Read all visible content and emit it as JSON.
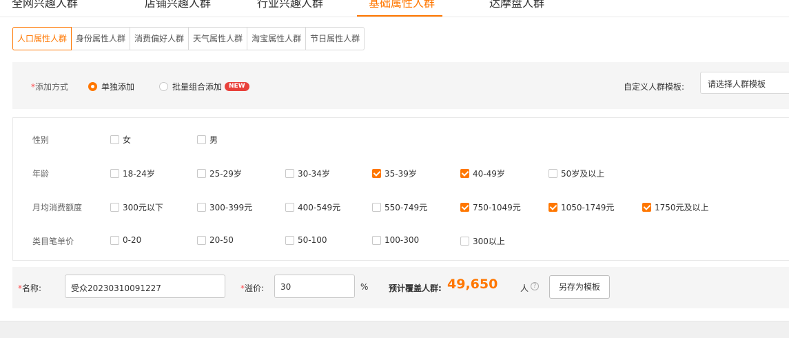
{
  "top_tabs": [
    {
      "label": "全网兴趣人群"
    },
    {
      "label": "店铺兴趣人群"
    },
    {
      "label": "行业兴趣人群"
    },
    {
      "label": "基础属性人群",
      "active": true
    },
    {
      "label": "达摩盘人群"
    }
  ],
  "sub_tabs": [
    {
      "label": "人口属性人群",
      "active": true
    },
    {
      "label": "身份属性人群"
    },
    {
      "label": "消费偏好人群"
    },
    {
      "label": "天气属性人群"
    },
    {
      "label": "淘宝属性人群"
    },
    {
      "label": "节日属性人群"
    }
  ],
  "add_mode": {
    "required_mark": "*",
    "label": "添加方式",
    "options": [
      {
        "label": "单独添加",
        "selected": true
      },
      {
        "label": "批量组合添加",
        "badge": "NEW",
        "selected": false
      }
    ],
    "template_label": "自定义人群模板:",
    "template_placeholder": "请选择人群模板"
  },
  "attributes": [
    {
      "label": "性别",
      "options": [
        {
          "text": "女",
          "checked": false
        },
        {
          "text": "男",
          "checked": false
        }
      ]
    },
    {
      "label": "年龄",
      "options": [
        {
          "text": "18-24岁",
          "checked": false
        },
        {
          "text": "25-29岁",
          "checked": false
        },
        {
          "text": "30-34岁",
          "checked": false
        },
        {
          "text": "35-39岁",
          "checked": true
        },
        {
          "text": "40-49岁",
          "checked": true
        },
        {
          "text": "50岁及以上",
          "checked": false
        }
      ]
    },
    {
      "label": "月均消费额度",
      "options": [
        {
          "text": "300元以下",
          "checked": false
        },
        {
          "text": "300-399元",
          "checked": false
        },
        {
          "text": "400-549元",
          "checked": false
        },
        {
          "text": "550-749元",
          "checked": false
        },
        {
          "text": "750-1049元",
          "checked": true
        },
        {
          "text": "1050-1749元",
          "checked": true
        },
        {
          "text": "1750元及以上",
          "checked": true
        }
      ]
    },
    {
      "label": "类目笔单价",
      "options": [
        {
          "text": "0-20",
          "checked": false
        },
        {
          "text": "20-50",
          "checked": false
        },
        {
          "text": "50-100",
          "checked": false
        },
        {
          "text": "100-300",
          "checked": false
        },
        {
          "text": "300以上",
          "checked": false
        }
      ]
    }
  ],
  "footer": {
    "required_mark": "*",
    "name_label": "名称:",
    "name_value": "受众20230310091227",
    "premium_label": "溢价:",
    "premium_value": "30",
    "percent": "%",
    "coverage_label": "预计覆盖人群:",
    "coverage_value": "49,650",
    "coverage_unit": "人",
    "help_icon": "?",
    "save_template_label": "另存为模板"
  },
  "colors": {
    "accent": "#ff7700",
    "required": "#ff4d4f",
    "badge": "#e8413b"
  }
}
